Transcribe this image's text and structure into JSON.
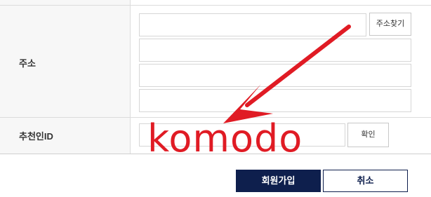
{
  "address": {
    "label": "주소",
    "search_button": "주소찾기"
  },
  "referrer": {
    "label": "추천인ID",
    "confirm_button": "확인"
  },
  "actions": {
    "signup_label": "회원가입",
    "cancel_label": "취소"
  },
  "overlay": {
    "watermark_text": "komodo",
    "arrow_icon": "red-arrow-icon",
    "color": "#e01b24"
  },
  "colors": {
    "primary": "#0e1f4d",
    "label_bg": "#f7f7f7"
  }
}
